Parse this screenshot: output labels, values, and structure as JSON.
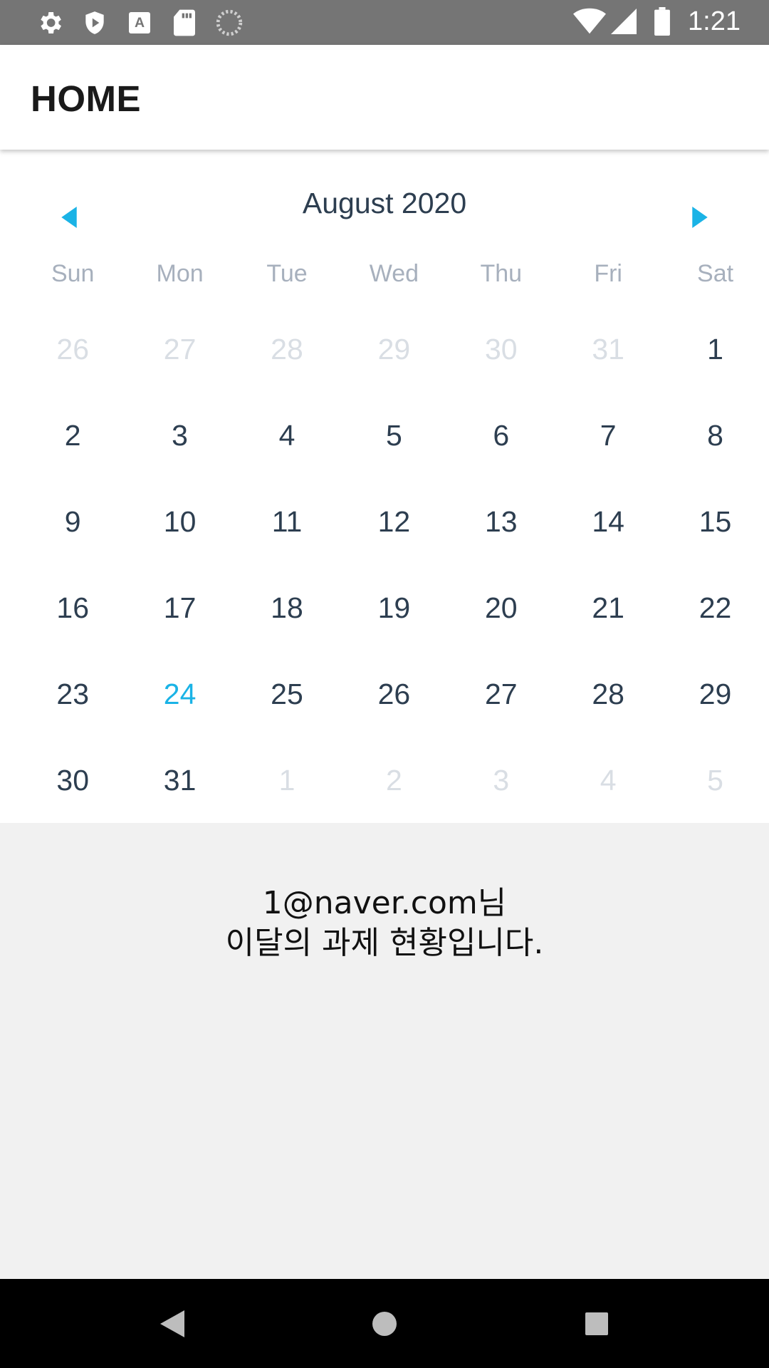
{
  "status_bar": {
    "time": "1:21",
    "left_icons": [
      "settings-icon",
      "shield-icon",
      "font-a-icon",
      "sd-card-icon",
      "loading-icon"
    ],
    "right_icons": [
      "wifi-icon",
      "signal-icon",
      "battery-icon"
    ]
  },
  "app_bar": {
    "title": "HOME"
  },
  "calendar": {
    "month_title": "August 2020",
    "prev_icon": "chevron-left-icon",
    "next_icon": "chevron-right-icon",
    "accent_color": "#1ab3e6",
    "weekdays": [
      "Sun",
      "Mon",
      "Tue",
      "Wed",
      "Thu",
      "Fri",
      "Sat"
    ],
    "days": [
      {
        "label": "26",
        "state": "muted"
      },
      {
        "label": "27",
        "state": "muted"
      },
      {
        "label": "28",
        "state": "muted"
      },
      {
        "label": "29",
        "state": "muted"
      },
      {
        "label": "30",
        "state": "muted"
      },
      {
        "label": "31",
        "state": "muted"
      },
      {
        "label": "1",
        "state": "normal"
      },
      {
        "label": "2",
        "state": "normal"
      },
      {
        "label": "3",
        "state": "normal"
      },
      {
        "label": "4",
        "state": "normal"
      },
      {
        "label": "5",
        "state": "normal"
      },
      {
        "label": "6",
        "state": "normal"
      },
      {
        "label": "7",
        "state": "normal"
      },
      {
        "label": "8",
        "state": "normal"
      },
      {
        "label": "9",
        "state": "normal"
      },
      {
        "label": "10",
        "state": "normal"
      },
      {
        "label": "11",
        "state": "normal"
      },
      {
        "label": "12",
        "state": "normal"
      },
      {
        "label": "13",
        "state": "normal"
      },
      {
        "label": "14",
        "state": "normal"
      },
      {
        "label": "15",
        "state": "normal"
      },
      {
        "label": "16",
        "state": "normal"
      },
      {
        "label": "17",
        "state": "normal"
      },
      {
        "label": "18",
        "state": "normal"
      },
      {
        "label": "19",
        "state": "normal"
      },
      {
        "label": "20",
        "state": "normal"
      },
      {
        "label": "21",
        "state": "normal"
      },
      {
        "label": "22",
        "state": "normal"
      },
      {
        "label": "23",
        "state": "normal"
      },
      {
        "label": "24",
        "state": "today"
      },
      {
        "label": "25",
        "state": "normal"
      },
      {
        "label": "26",
        "state": "normal"
      },
      {
        "label": "27",
        "state": "normal"
      },
      {
        "label": "28",
        "state": "normal"
      },
      {
        "label": "29",
        "state": "normal"
      },
      {
        "label": "30",
        "state": "normal"
      },
      {
        "label": "31",
        "state": "normal"
      },
      {
        "label": "1",
        "state": "muted"
      },
      {
        "label": "2",
        "state": "muted"
      },
      {
        "label": "3",
        "state": "muted"
      },
      {
        "label": "4",
        "state": "muted"
      },
      {
        "label": "5",
        "state": "muted"
      }
    ]
  },
  "greeting": {
    "line1": "1@naver.com님",
    "line2": "이달의 과제 현황입니다."
  },
  "nav_bar": {
    "icons": [
      "back-icon",
      "home-icon",
      "recents-icon"
    ]
  }
}
